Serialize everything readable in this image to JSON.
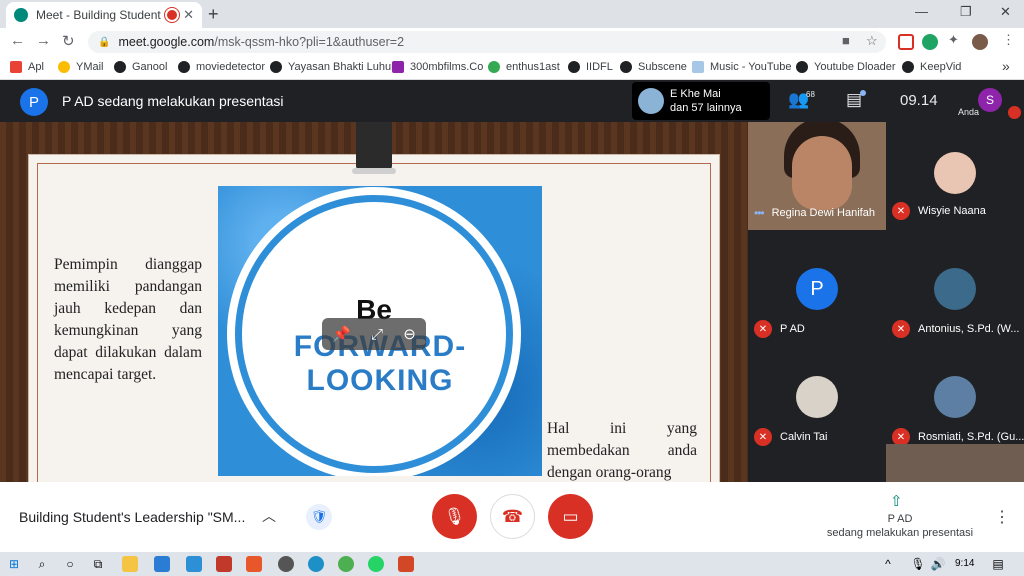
{
  "browser": {
    "tab_title": "Meet - Building Student's Le",
    "tab_close": "✕",
    "new_tab": "+",
    "url_host": "meet.google.com",
    "url_path": "/msk-qssm-hko?pli=1&authuser=2",
    "win_minimize": "—",
    "win_restore": "❐",
    "win_close": "✕"
  },
  "bookmarks": [
    "Apl",
    "YMail",
    "Ganool",
    "moviedetector",
    "Yayasan Bhakti Luhur",
    "300mbfilms.Co",
    "enthus1ast",
    "IIDFL",
    "Subscene",
    "Music - YouTube",
    "Youtube Dloader",
    "KeepVid"
  ],
  "bookmarks_more": "»",
  "meet_header": {
    "presenter_initial": "P",
    "presenting_text": "P AD sedang melakukan presentasi",
    "people_line1": "E Khe Mai",
    "people_line2": "dan 57 lainnya",
    "people_count": "68",
    "clock": "09.14",
    "self_initial": "S",
    "self_label": "Anda"
  },
  "slide": {
    "para1": "Pemimpin dianggap memiliki pandangan jauh kedepan dan kemungkinan yang dapat dilakukan dalam mencapai target.",
    "be": "Be",
    "forward": "FORWARD-",
    "looking": "LOOKING",
    "para2": "Hal ini yang membedakan anda dengan orang-orang"
  },
  "participants": [
    {
      "name": "Regina Dewi Hanifah",
      "speaking": true
    },
    {
      "name": "Wisyie Naana",
      "muted": true
    },
    {
      "name": "P AD",
      "initial": "P",
      "muted": true
    },
    {
      "name": "Antonius, S.Pd. (W...",
      "muted": true
    },
    {
      "name": "Calvin Tai",
      "muted": true
    },
    {
      "name": "Rosmiati, S.Pd. (Gu...",
      "muted": true
    }
  ],
  "bottom": {
    "meeting_title": "Building Student's Leadership \"SM...",
    "presenter_name": "P AD",
    "presenter_sub": "sedang melakukan presentasi"
  },
  "taskbar": {
    "time": "9:14"
  },
  "colors": {
    "meet_bg": "#202124",
    "danger": "#d93025",
    "accent": "#1a73e8",
    "teal": "#00897b"
  }
}
